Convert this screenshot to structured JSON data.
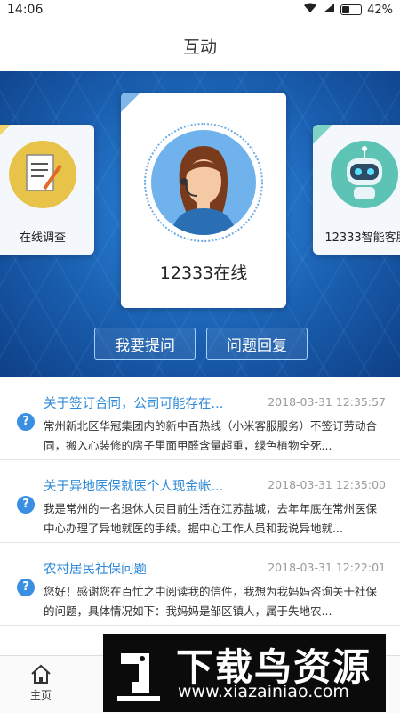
{
  "status_bar": {
    "time": "14:06",
    "battery": "42%"
  },
  "header": {
    "title": "互动"
  },
  "carousel": {
    "left_card": {
      "label": "在线调查"
    },
    "center_card": {
      "label": "12333在线"
    },
    "right_card": {
      "label": "12333智能客服"
    }
  },
  "actions": {
    "ask_label": "我要提问",
    "reply_label": "问题回复"
  },
  "questions": [
    {
      "title": "关于签订合同，公司可能存在...",
      "time": "2018-03-31 12:35:57",
      "body": "常州新北区华冠集团内的新中百热线（小米客服服务）不签订劳动合同，搬入心装修的房子里面甲醛含量超重，绿色植物全死..."
    },
    {
      "title": "关于异地医保就医个人现金帐...",
      "time": "2018-03-31 12:35:00",
      "body": "我是常州的一名退休人员目前生活在江苏盐城，去年年底在常州医保中心办理了异地就医的手续。据中心工作人员和我说异地就..."
    },
    {
      "title": "农村居民社保问题",
      "time": "2018-03-31 12:22:01",
      "body": "您好！感谢您在百忙之中阅读我的信件，我想为我妈妈咨询关于社保的问题，具体情况如下：我妈妈是邹区镇人，属于失地农..."
    }
  ],
  "tabbar": {
    "home_label": "主页"
  },
  "watermark": {
    "title": "下载鸟资源",
    "url": "www.xiazainiao.com"
  },
  "colors": {
    "accent": "#2f8ad8",
    "banner": "#1a5fb0",
    "question_icon": "#3a8fe3"
  }
}
